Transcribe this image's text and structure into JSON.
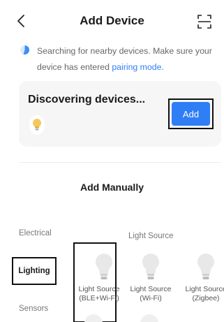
{
  "header": {
    "title": "Add Device",
    "back_icon": "chevron-left-icon",
    "scan_icon": "scan-icon"
  },
  "notice": {
    "text": "Searching for nearby devices. Make sure your device has entered ",
    "link": "pairing mode",
    "suffix": "."
  },
  "discovering": {
    "title": "Discovering devices...",
    "add_label": "Add"
  },
  "manual": {
    "title": "Add Manually"
  },
  "categories": {
    "electrical": "Electrical",
    "lighting": "Lighting",
    "sensors": "Sensors"
  },
  "group": {
    "title": "Light Source"
  },
  "devices": [
    {
      "label": "Light Source (BLE+Wi-Fi)"
    },
    {
      "label": "Light Source (Wi-Fi)"
    },
    {
      "label": "Light Source (Zigbee)"
    }
  ],
  "colors": {
    "accent": "#2f7ef6",
    "card_bg": "#f6f6f7",
    "highlight_border": "#111111"
  }
}
